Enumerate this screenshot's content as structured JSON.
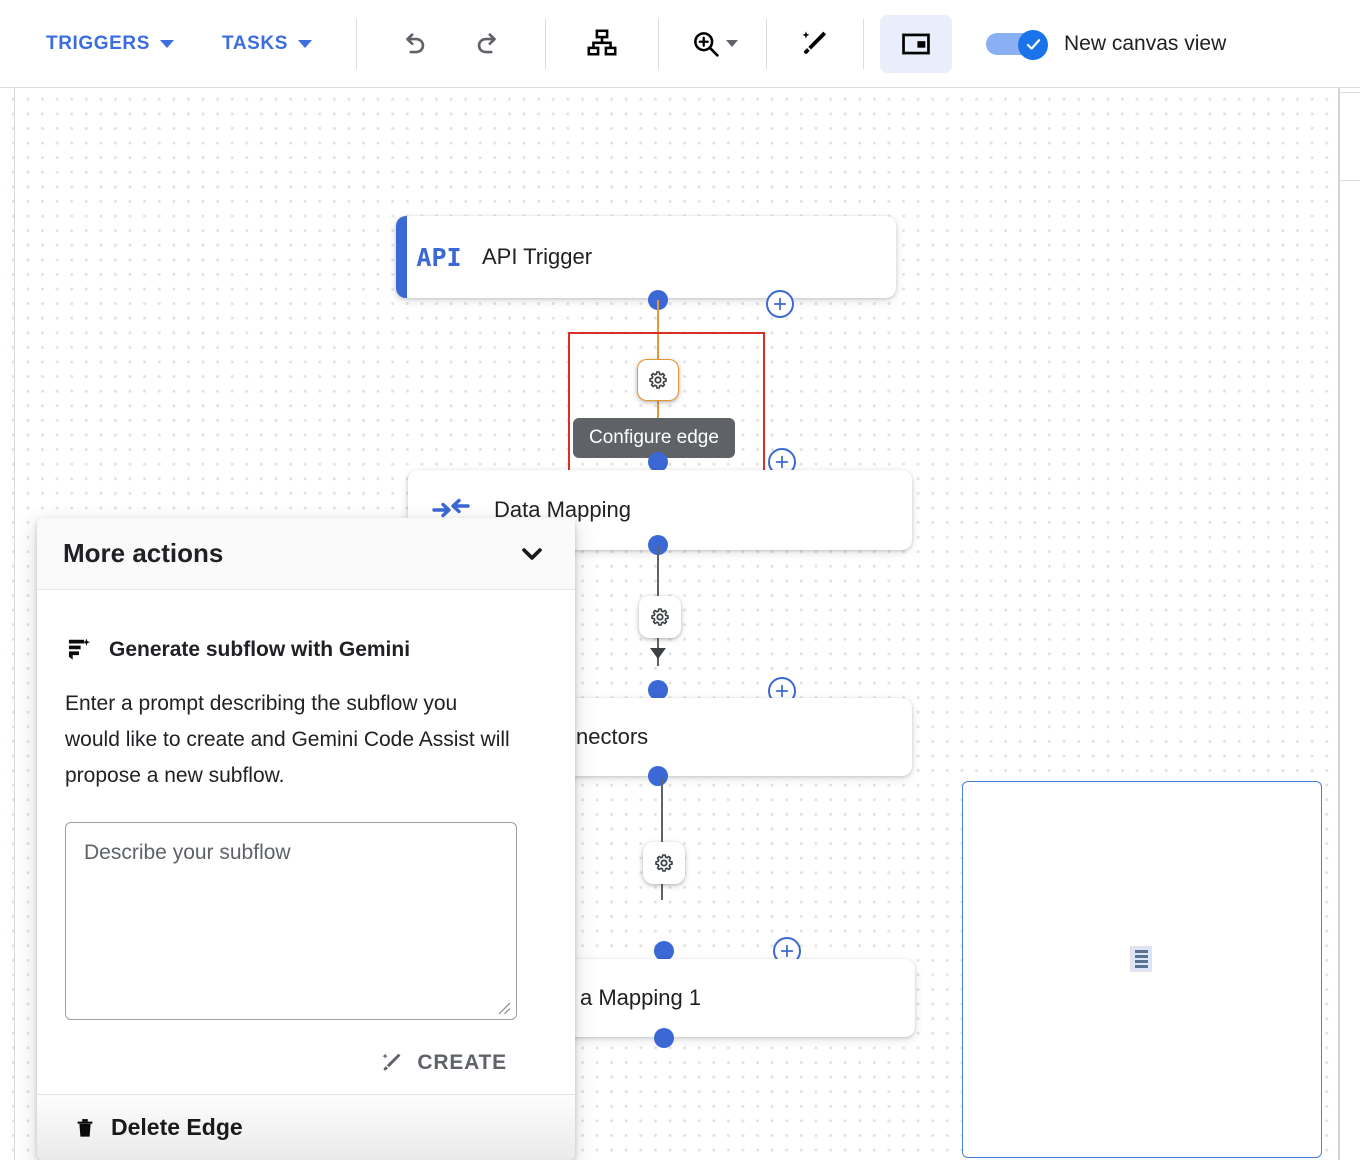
{
  "toolbar": {
    "triggers_label": "TRIGGERS",
    "tasks_label": "TASKS",
    "undo_icon": "undo-icon",
    "redo_icon": "redo-icon",
    "layout_icon": "auto-layout-icon",
    "zoom_icon": "zoom-in-icon",
    "magic_icon": "magic-wand-icon",
    "panel_icon": "toggle-side-panel-icon",
    "toggle_label": "New canvas view",
    "toggle_state": "on",
    "accent_color": "#3c6ee0",
    "toggle_color": "#1a73e8"
  },
  "canvas": {
    "nodes": [
      {
        "title": "API Trigger",
        "icon": "api-icon",
        "icon_text": "API",
        "accent": true
      },
      {
        "title": "Data Mapping",
        "icon": "data-mapping-icon",
        "icon_text": "",
        "accent": false
      },
      {
        "title": "nectors",
        "icon": "",
        "icon_text": "",
        "accent": false
      },
      {
        "title": "a Mapping 1",
        "icon": "",
        "icon_text": "",
        "accent": false
      }
    ],
    "edge_tooltip": "Configure edge",
    "edge_gear_icon": "gear-icon",
    "add_node_icon": "plus-circle-icon",
    "selected_edge_color": "#d93025",
    "active_edge_color": "#e8962f"
  },
  "panel": {
    "header_title": "More actions",
    "collapse_icon": "chevron-down-icon",
    "gemini_icon": "gemini-generate-icon",
    "gemini_title": "Generate subflow with Gemini",
    "gemini_description": "Enter a prompt describing the subflow you would like to create and Gemini Code Assist will propose a new subflow.",
    "subflow_placeholder": "Describe your subflow",
    "subflow_value": "",
    "create_label": "CREATE",
    "create_icon": "magic-wand-icon",
    "delete_label": "Delete Edge",
    "delete_icon": "trash-icon"
  }
}
